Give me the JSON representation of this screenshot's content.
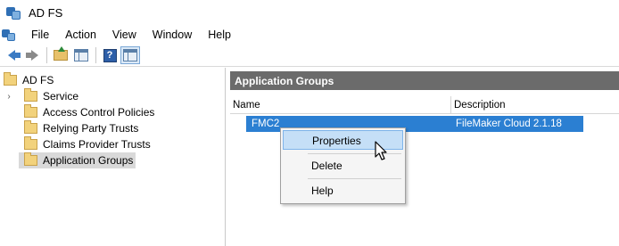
{
  "window": {
    "title": "AD FS"
  },
  "menu": {
    "items": [
      "File",
      "Action",
      "View",
      "Window",
      "Help"
    ]
  },
  "toolbar": {
    "buttons": [
      "back-icon",
      "forward-icon",
      "folder-up-icon",
      "show-hide-tree-icon",
      "help-icon",
      "show-hide-action-pane-icon"
    ],
    "help_glyph": "?"
  },
  "tree": {
    "root": "AD FS",
    "items": [
      "Service",
      "Access Control Policies",
      "Relying Party Trusts",
      "Claims Provider Trusts",
      "Application Groups"
    ],
    "selected": "Application Groups"
  },
  "main": {
    "header": "Application Groups",
    "columns": [
      "Name",
      "Description"
    ],
    "rows": [
      {
        "name": "FMC2",
        "description": "FileMaker Cloud 2.1.18"
      }
    ]
  },
  "context_menu": {
    "items": [
      "Properties",
      "Delete",
      "Help"
    ],
    "hovered": "Properties"
  },
  "colors": {
    "selection": "#2b7fd2",
    "header_bar": "#6b6b6b",
    "menu_hover": "#c5dff7"
  }
}
